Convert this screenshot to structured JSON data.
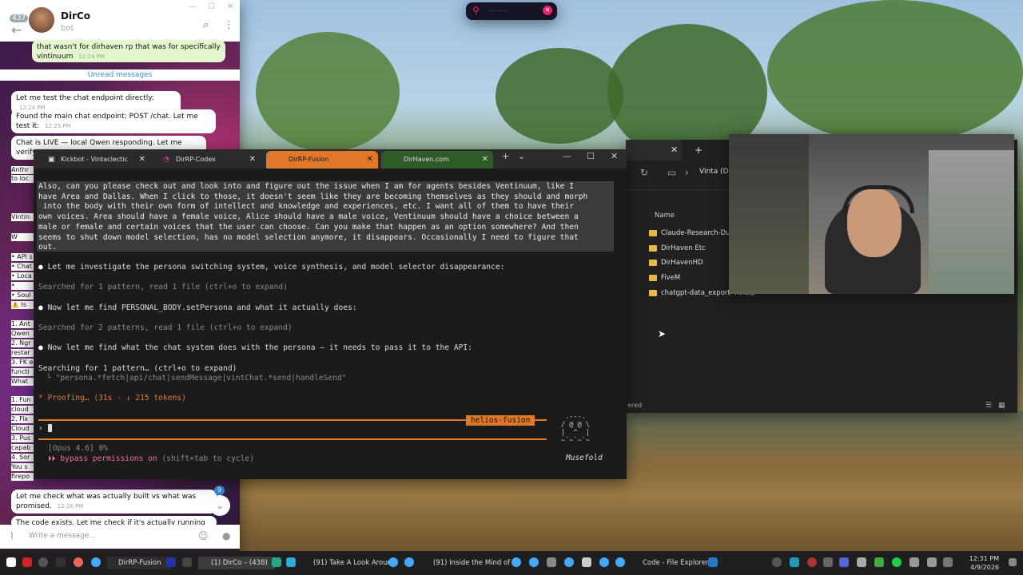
{
  "telegram": {
    "unread_count": "437",
    "contact_name": "DirCo",
    "contact_status": "bot",
    "partial_message": "that wasn't for dirhaven rp that was for specifically vintinuum",
    "partial_time": "12:24 PM",
    "unread_label": "Unread messages",
    "messages": [
      {
        "text": "Let me test the chat endpoint directly:",
        "time": "12:24 PM"
      },
      {
        "text": "Found the main chat endpoint: POST /chat. Let me test it:",
        "time": "12:25 PM"
      },
      {
        "text": "Chat is LIVE — local Qwen responding. Let me verify",
        "time": ""
      },
      {
        "text": "Let me check what was actually built vs what was promised.",
        "time": "12:26 PM"
      },
      {
        "text": "The code exists. Let me check if it's actually running and if",
        "time": ""
      }
    ],
    "clipped_fragments": [
      "Anthr",
      "to loc",
      "Vintin",
      "W",
      "• API s",
      "• Chat",
      "• Loca",
      "• Know",
      "• Soul",
      "⚠️ Is",
      "1. Ant",
      "Qwen",
      "2. Ngr",
      "restar",
      "3. FK e",
      "functi",
      "What",
      "1. Fun",
      "cloud",
      "2. Fix",
      "Cloud",
      "3. Pus",
      "capab",
      "4. Sor",
      "You s",
      "firepo"
    ],
    "scroll_badge": "9",
    "compose_placeholder": "Write a message..."
  },
  "overlay": {
    "text": "........"
  },
  "terminal": {
    "tabs": [
      {
        "label": "Kickbot - Vintaclectic",
        "active": false
      },
      {
        "label": "DirRP-Codex",
        "active": false
      },
      {
        "label": "DirRP-Fusion",
        "active": true
      },
      {
        "label": "DirHaven.com",
        "active": false
      }
    ],
    "prompt_text": "Also, can you please check out and look into and figure out the issue when I am for agents besides Ventinuum, like I\nhave Area and Dallas. When I click to those, it doesn't seem like they are becoming themselves as they should and morph\n into the body with their own form of intellect and knowledge and experiences, etc. I want all of them to have their\nown voices. Area should have a female voice, Alice should have a male voice, Ventinuum should have a choice between a\nmale or female and certain voices that the user can choose. Can you make that happen as an option somewhere? And then\nseems to shut down model selection, has no model selection anymore, it disappears. Occasionally I need to figure that\nout.",
    "lines": [
      {
        "kind": "bullet",
        "text": "Let me investigate the persona switching system, voice synthesis, and model selector disappearance:"
      },
      {
        "kind": "dim",
        "text": "Searched for 1 pattern, read 1 file (ctrl+o to expand)"
      },
      {
        "kind": "bullet",
        "text": "Now let me find PERSONAL_BODY.setPersona and what it actually does:"
      },
      {
        "kind": "dim",
        "text": "Searched for 2 patterns, read 1 file (ctrl+o to expand)"
      },
      {
        "kind": "bullet",
        "text": "Now let me find what the chat system does with the persona — it needs to pass it to the API:"
      }
    ],
    "searching": "Searching for 1 pattern… (ctrl+o to expand)",
    "searching_detail": "\"persona.*fetch|api/chat|sendMessage|vintChat.*send|handleSend\"",
    "proofing": "Proofing… (31s · ↓ 215 tokens)",
    "helios_label": "helios-fusion",
    "status_model": "[Opus 4.6] 0%",
    "bypass_label": "bypass permissions on",
    "bypass_hint": "(shift+tab to cycle)",
    "ascii_art": " .---.\n/ @ @ \\\n|  ^  |\n~`~`~`~",
    "brand": "Musefold"
  },
  "explorer": {
    "path": "Vinta (D:",
    "column_name": "Name",
    "folders": [
      "Claude-Research-Dump",
      "DirHaven Etc",
      "DirHavenHD",
      "FiveM",
      "chatgpt-data_export-4.9.zip"
    ],
    "status_fragment": "ered"
  },
  "taskbar": {
    "items": [
      "DirRP-Fusion",
      "(1) DirCo – (438)",
      "(91) Take A Look Arounc",
      "(91) Inside the Mind of a",
      "Code - File Explorer"
    ],
    "time": "12:31 PM",
    "date": "4/9/2026"
  }
}
